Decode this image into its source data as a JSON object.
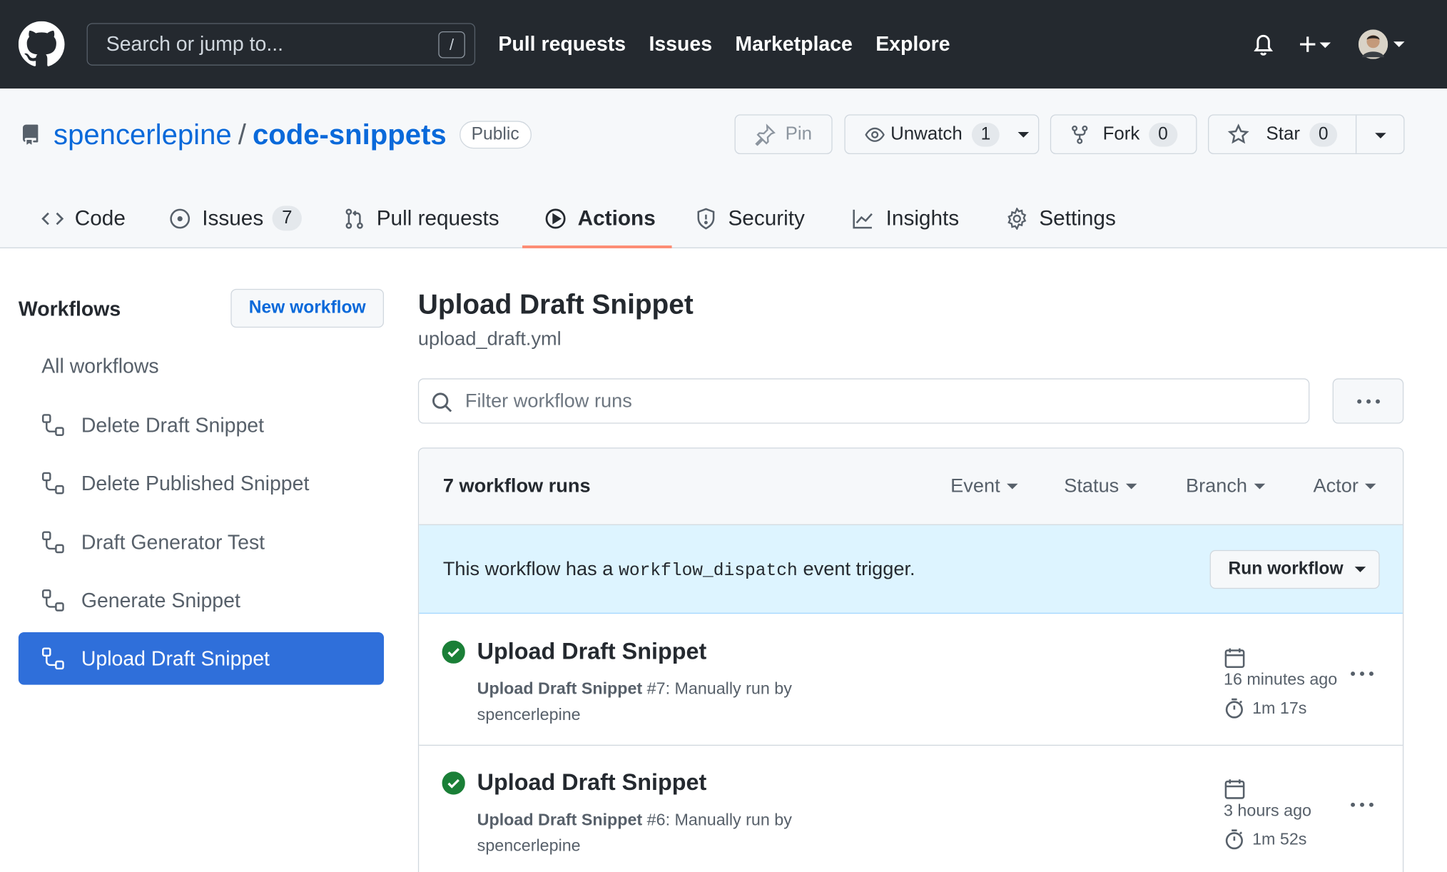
{
  "header": {
    "search_placeholder": "Search or jump to...",
    "search_shortcut": "/",
    "nav": [
      "Pull requests",
      "Issues",
      "Marketplace",
      "Explore"
    ]
  },
  "repo": {
    "owner": "spencerlepine",
    "separator": "/",
    "name": "code-snippets",
    "visibility": "Public",
    "pin_label": "Pin",
    "unwatch_label": "Unwatch",
    "unwatch_count": "1",
    "fork_label": "Fork",
    "fork_count": "0",
    "star_label": "Star",
    "star_count": "0"
  },
  "tabs": [
    {
      "label": "Code",
      "icon": "code-icon"
    },
    {
      "label": "Issues",
      "icon": "issue-opened-icon",
      "count": "7"
    },
    {
      "label": "Pull requests",
      "icon": "git-pull-request-icon"
    },
    {
      "label": "Actions",
      "icon": "play-icon",
      "active": true
    },
    {
      "label": "Security",
      "icon": "shield-icon"
    },
    {
      "label": "Insights",
      "icon": "graph-icon"
    },
    {
      "label": "Settings",
      "icon": "gear-icon"
    }
  ],
  "sidebar": {
    "title": "Workflows",
    "new_workflow": "New workflow",
    "all_workflows": "All workflows",
    "items": [
      {
        "label": "Delete Draft Snippet"
      },
      {
        "label": "Delete Published Snippet"
      },
      {
        "label": "Draft Generator Test"
      },
      {
        "label": "Generate Snippet"
      },
      {
        "label": "Upload Draft Snippet",
        "active": true
      }
    ]
  },
  "main": {
    "title": "Upload Draft Snippet",
    "file": "upload_draft.yml",
    "filter_placeholder": "Filter workflow runs",
    "runs_count": "7 workflow runs",
    "filters": [
      "Event",
      "Status",
      "Branch",
      "Actor"
    ],
    "dispatch": {
      "prefix": "This workflow has a",
      "code": "workflow_dispatch",
      "suffix": "event trigger.",
      "button": "Run workflow"
    },
    "runs": [
      {
        "title": "Upload Draft Snippet",
        "workflow": "Upload Draft Snippet",
        "detail": "#7: Manually run by",
        "actor": "spencerlepine",
        "time": "16 minutes ago",
        "duration": "1m 17s",
        "status": "success"
      },
      {
        "title": "Upload Draft Snippet",
        "workflow": "Upload Draft Snippet",
        "detail": "#6: Manually run by",
        "actor": "spencerlepine",
        "time": "3 hours ago",
        "duration": "1m 52s",
        "status": "success"
      }
    ]
  },
  "colors": {
    "header_bg": "#24292f",
    "link": "#0969da",
    "active_tab_underline": "#fd8c73",
    "active_workflow_bg": "#2f6fda",
    "success": "#1a7f37",
    "dispatch_bg": "#ddf4ff"
  }
}
